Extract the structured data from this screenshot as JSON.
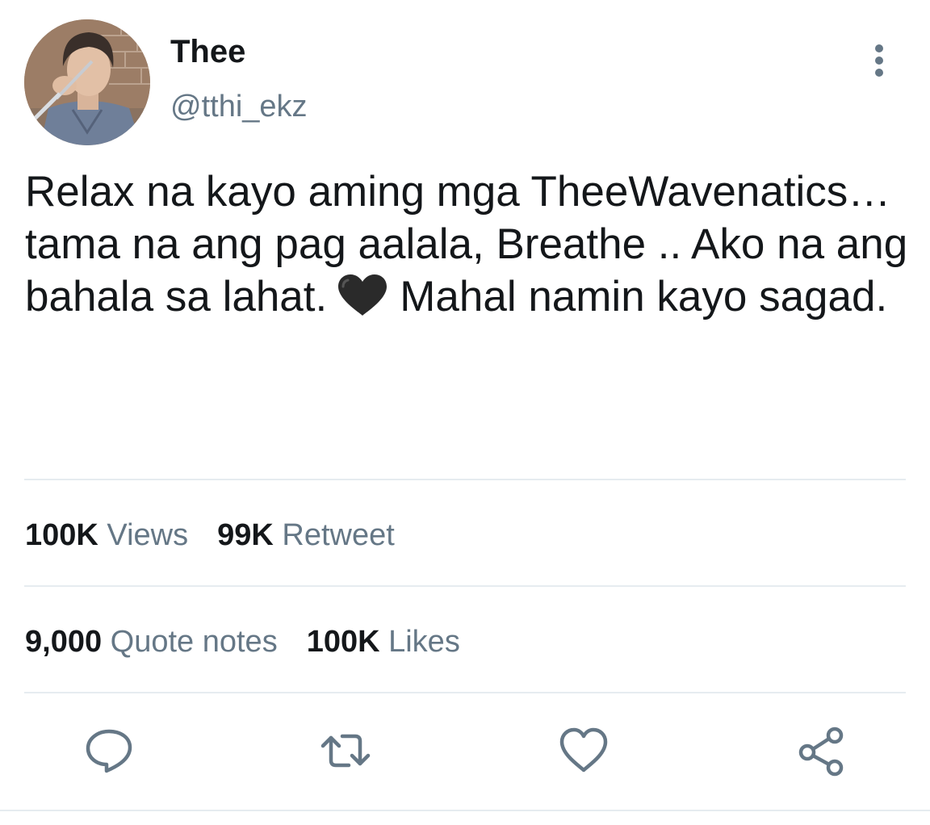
{
  "user": {
    "display_name": "Thee",
    "handle": "@tthi_ekz"
  },
  "tweet": {
    "text_before_emoji": "Relax na kayo aming mga TheeWavenatics… tama na ang pag aalala, Breathe .. Ako na ang bahala sa lahat.",
    "emoji": "black-heart",
    "text_after_emoji": "Mahal namin kayo sagad."
  },
  "stats": {
    "views": {
      "value": "100K",
      "label": "Views"
    },
    "retweets": {
      "value": "99K",
      "label": "Retweet"
    },
    "quotes": {
      "value": "9,000",
      "label": "Quote notes"
    },
    "likes": {
      "value": "100K",
      "label": "Likes"
    }
  },
  "actions": [
    {
      "name": "reply",
      "icon": "reply-icon"
    },
    {
      "name": "retweet",
      "icon": "retweet-icon"
    },
    {
      "name": "like",
      "icon": "heart-icon"
    },
    {
      "name": "share",
      "icon": "share-icon"
    }
  ],
  "colors": {
    "text_primary": "#14171a",
    "text_secondary": "#657786",
    "divider": "#e6ecf0",
    "icon": "#657786"
  }
}
